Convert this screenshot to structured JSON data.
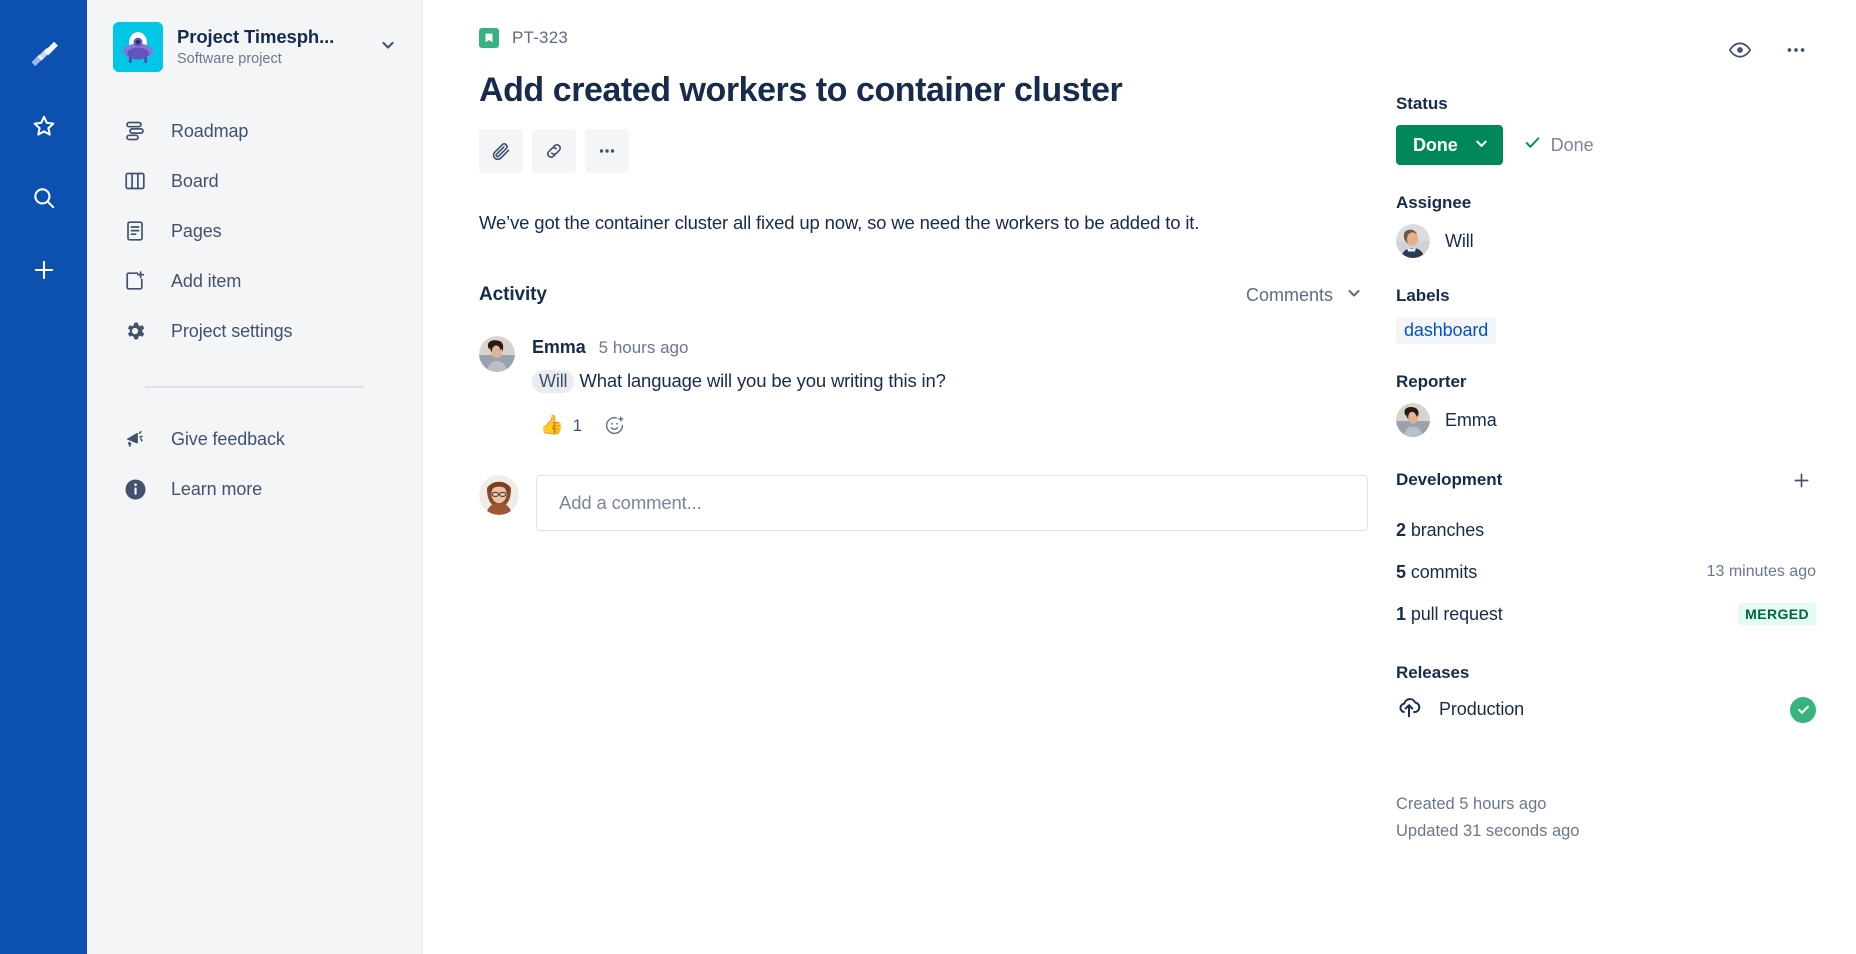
{
  "rail": {
    "items": [
      {
        "name": "jira-logo",
        "label": "Jira"
      },
      {
        "name": "starred",
        "label": "Starred"
      },
      {
        "name": "search",
        "label": "Search"
      },
      {
        "name": "create",
        "label": "Create"
      }
    ]
  },
  "sidebar": {
    "project": {
      "name": "Project Timesph...",
      "type": "Software project",
      "avatar_bg": "#00c7e6"
    },
    "items": [
      {
        "label": "Roadmap",
        "icon": "roadmap-icon"
      },
      {
        "label": "Board",
        "icon": "board-icon"
      },
      {
        "label": "Pages",
        "icon": "pages-icon"
      },
      {
        "label": "Add item",
        "icon": "add-item-icon"
      },
      {
        "label": "Project settings",
        "icon": "settings-gear-icon"
      }
    ],
    "footer_items": [
      {
        "label": "Give feedback",
        "icon": "megaphone-icon"
      },
      {
        "label": "Learn more",
        "icon": "info-icon"
      }
    ]
  },
  "issue": {
    "key": "PT-323",
    "type_color": "#36b37e",
    "title": "Add created workers to container cluster",
    "description": "We’ve got the container cluster all fixed up now, so we need the workers to be added to it.",
    "actions": [
      {
        "name": "attach-button",
        "icon": "paperclip-icon"
      },
      {
        "name": "link-button",
        "icon": "link-icon"
      },
      {
        "name": "more-actions-button",
        "icon": "ellipsis-icon"
      }
    ]
  },
  "activity": {
    "title": "Activity",
    "filter_label": "Comments",
    "comments": [
      {
        "author": "Emma",
        "time": "5 hours ago",
        "mention": "Will",
        "text": "What language will you be you writing this in?",
        "reaction_emoji": "👍",
        "reaction_count": "1"
      }
    ],
    "comment_placeholder": "Add a comment...",
    "comment_value": ""
  },
  "details": {
    "top_actions": [
      {
        "name": "watch-icon",
        "label": "Watch"
      },
      {
        "name": "more-options-icon",
        "label": "More"
      }
    ],
    "status": {
      "label": "Status",
      "value": "Done",
      "color": "#00875a",
      "note": "Done"
    },
    "assignee": {
      "label": "Assignee",
      "name": "Will"
    },
    "labels": {
      "label": "Labels",
      "values": [
        "dashboard"
      ]
    },
    "reporter": {
      "label": "Reporter",
      "name": "Emma"
    },
    "development": {
      "label": "Development",
      "rows": [
        {
          "count": "2",
          "noun": " branches",
          "meta": "",
          "badge": ""
        },
        {
          "count": "5",
          "noun": " commits",
          "meta": "13 minutes ago",
          "badge": ""
        },
        {
          "count": "1",
          "noun": " pull request",
          "meta": "",
          "badge": "MERGED"
        }
      ]
    },
    "releases": {
      "label": "Releases",
      "items": [
        {
          "name": "Production",
          "status": "deployed"
        }
      ]
    },
    "created": "Created 5 hours ago",
    "updated": "Updated 31 seconds ago"
  }
}
